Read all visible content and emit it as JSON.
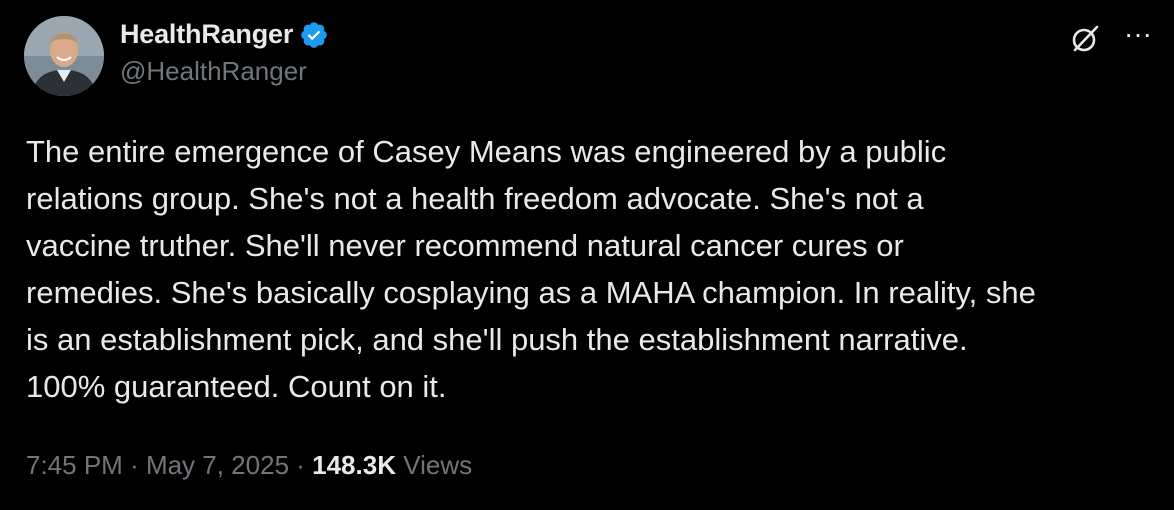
{
  "author": {
    "display_name": "HealthRanger",
    "handle": "@HealthRanger",
    "verified": true,
    "verified_color": "#1d9bf0"
  },
  "icons": {
    "avatar": "avatar-photo",
    "verified": "verified-badge-icon",
    "grok": "grok-icon",
    "more": "more-options-icon",
    "more_glyph": "···"
  },
  "tweet": {
    "text": "The entire emergence of Casey Means was engineered by a public\nrelations group. She's not a health freedom advocate. She's not a\nvaccine truther. She'll never recommend natural cancer cures or\nremedies. She's basically cosplaying as a MAHA champion. In reality, she\nis an establishment pick, and she'll push the establishment narrative.\n100% guaranteed. Count on it."
  },
  "meta": {
    "time": "7:45 PM",
    "separator": " · ",
    "date": "May 7, 2025",
    "views_count": "148.3K",
    "views_label": " Views"
  },
  "colors": {
    "background": "#000000",
    "primary_text": "#e7e9ea",
    "secondary_text": "#71767b"
  }
}
